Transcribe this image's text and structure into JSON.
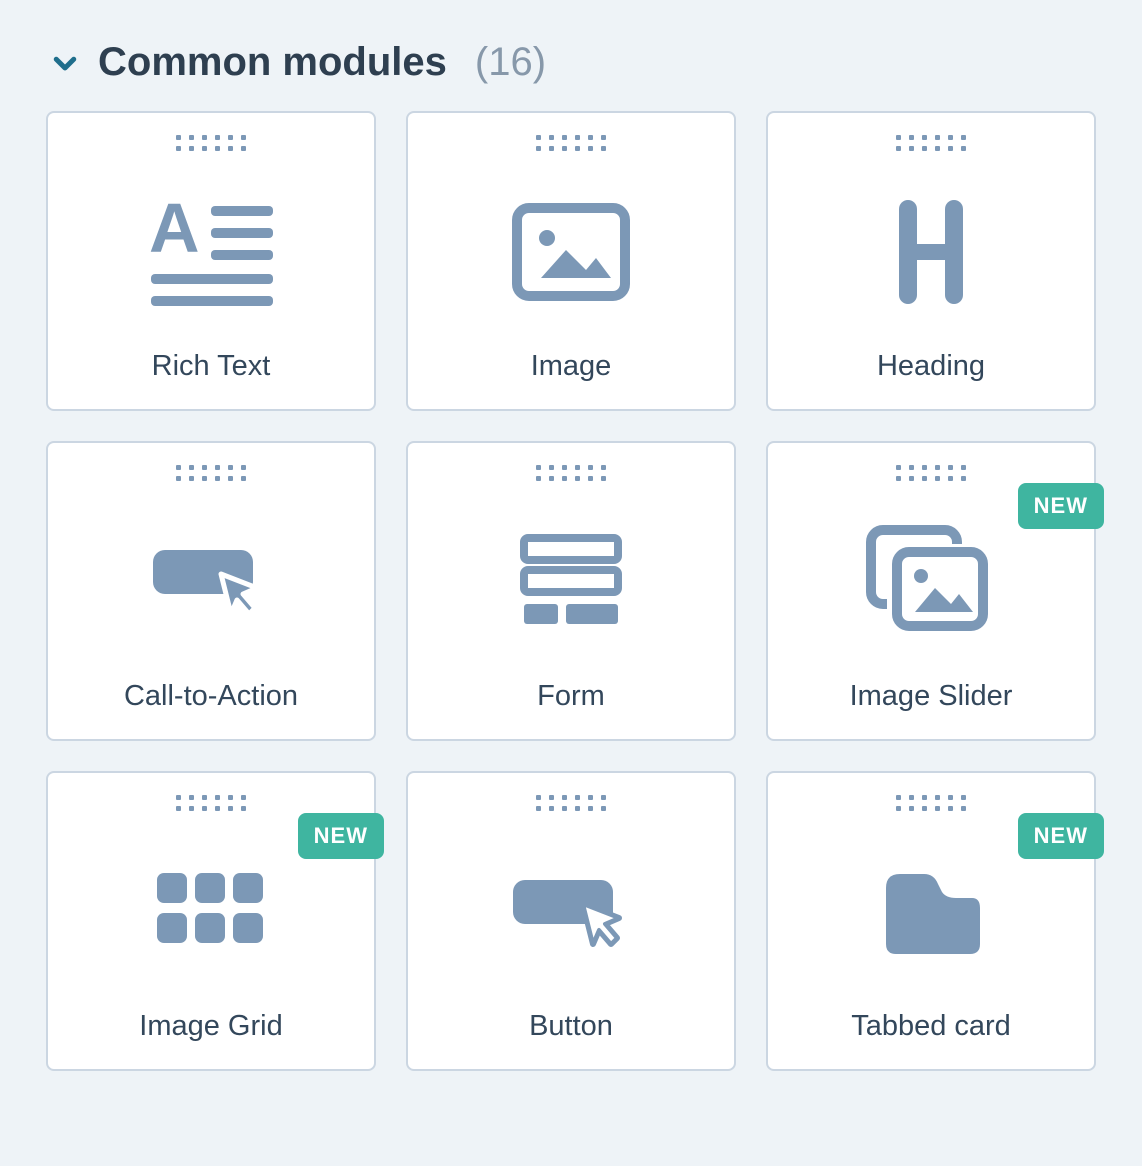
{
  "section": {
    "title": "Common modules",
    "count_display": "(16)"
  },
  "badge_text": "NEW",
  "icon_color": "#7c98b6",
  "modules": [
    {
      "label": "Rich Text",
      "icon": "rich-text-icon",
      "new": false
    },
    {
      "label": "Image",
      "icon": "image-icon",
      "new": false
    },
    {
      "label": "Heading",
      "icon": "heading-icon",
      "new": false
    },
    {
      "label": "Call-to-Action",
      "icon": "cta-icon",
      "new": false
    },
    {
      "label": "Form",
      "icon": "form-icon",
      "new": false
    },
    {
      "label": "Image Slider",
      "icon": "image-slider-icon",
      "new": true
    },
    {
      "label": "Image Grid",
      "icon": "image-grid-icon",
      "new": true
    },
    {
      "label": "Button",
      "icon": "button-icon",
      "new": false
    },
    {
      "label": "Tabbed card",
      "icon": "tabbed-card-icon",
      "new": true
    }
  ]
}
